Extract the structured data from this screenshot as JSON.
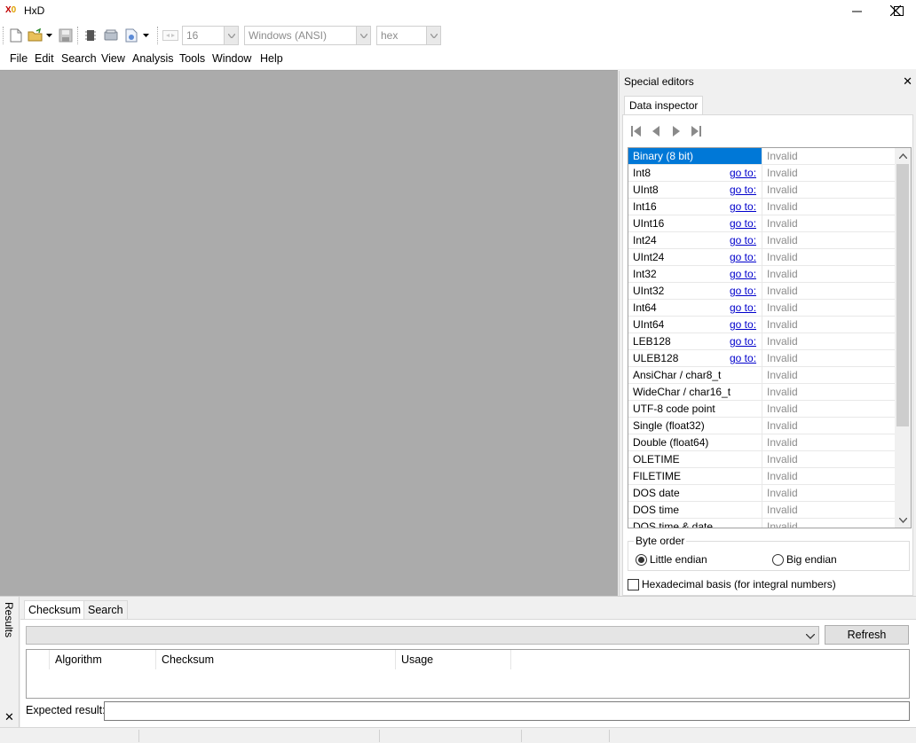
{
  "window": {
    "title": "HxD"
  },
  "toolbar": {
    "bytes_per_row": "16",
    "charset": "Windows (ANSI)",
    "offset_base": "hex"
  },
  "menu": [
    "File",
    "Edit",
    "Search",
    "View",
    "Analysis",
    "Tools",
    "Window",
    "Help"
  ],
  "special_editors": {
    "title": "Special editors",
    "tab": "Data inspector",
    "goto_label": "go to:",
    "rows": [
      {
        "name": "Binary (8 bit)",
        "value": "Invalid"
      },
      {
        "name": "Int8",
        "value": "Invalid"
      },
      {
        "name": "UInt8",
        "value": "Invalid"
      },
      {
        "name": "Int16",
        "value": "Invalid"
      },
      {
        "name": "UInt16",
        "value": "Invalid"
      },
      {
        "name": "Int24",
        "value": "Invalid"
      },
      {
        "name": "UInt24",
        "value": "Invalid"
      },
      {
        "name": "Int32",
        "value": "Invalid"
      },
      {
        "name": "UInt32",
        "value": "Invalid"
      },
      {
        "name": "Int64",
        "value": "Invalid"
      },
      {
        "name": "UInt64",
        "value": "Invalid"
      },
      {
        "name": "LEB128",
        "value": "Invalid"
      },
      {
        "name": "ULEB128",
        "value": "Invalid"
      },
      {
        "name": "AnsiChar / char8_t",
        "value": "Invalid"
      },
      {
        "name": "WideChar / char16_t",
        "value": "Invalid"
      },
      {
        "name": "UTF-8 code point",
        "value": "Invalid"
      },
      {
        "name": "Single (float32)",
        "value": "Invalid"
      },
      {
        "name": "Double (float64)",
        "value": "Invalid"
      },
      {
        "name": "OLETIME",
        "value": "Invalid"
      },
      {
        "name": "FILETIME",
        "value": "Invalid"
      },
      {
        "name": "DOS date",
        "value": "Invalid"
      },
      {
        "name": "DOS time",
        "value": "Invalid"
      },
      {
        "name": "DOS time & date",
        "value": "Invalid"
      }
    ],
    "byte_order": {
      "label": "Byte order",
      "little": "Little endian",
      "big": "Big endian"
    },
    "hex_basis": "Hexadecimal basis (for integral numbers)"
  },
  "results": {
    "label": "Results",
    "tabs": [
      "Checksum",
      "Search"
    ],
    "refresh": "Refresh",
    "columns": [
      "Algorithm",
      "Checksum",
      "Usage"
    ],
    "expected_label": "Expected result:"
  }
}
